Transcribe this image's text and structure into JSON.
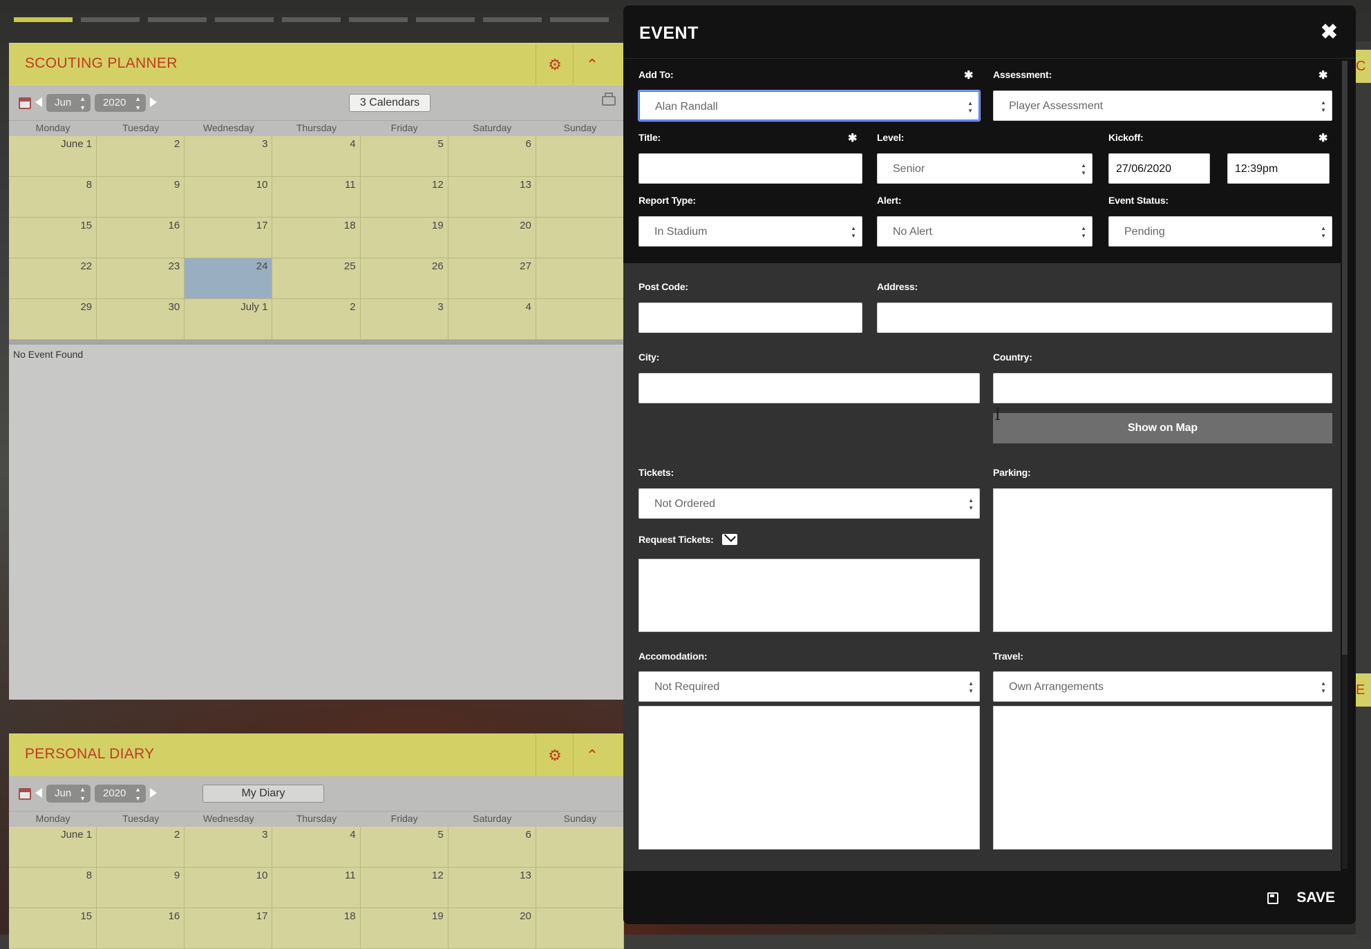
{
  "scouting": {
    "title": "SCOUTING PLANNER",
    "month": "Jun",
    "year": "2020",
    "calendars_label": "3 Calendars",
    "no_event": "No Event Found"
  },
  "days": [
    "Monday",
    "Tuesday",
    "Wednesday",
    "Thursday",
    "Friday",
    "Saturday",
    "Sunday"
  ],
  "weeks": [
    [
      "June 1",
      "2",
      "3",
      "4",
      "5",
      "6",
      ""
    ],
    [
      "8",
      "9",
      "10",
      "11",
      "12",
      "13",
      ""
    ],
    [
      "15",
      "16",
      "17",
      "18",
      "19",
      "20",
      ""
    ],
    [
      "22",
      "23",
      "24",
      "25",
      "26",
      "27",
      ""
    ],
    [
      "29",
      "30",
      "July 1",
      "2",
      "3",
      "4",
      ""
    ]
  ],
  "diary": {
    "title": "PERSONAL DIARY",
    "month": "Jun",
    "year": "2020",
    "calendars_label": "My Diary"
  },
  "diary_weeks": [
    [
      "June 1",
      "2",
      "3",
      "4",
      "5",
      "6",
      ""
    ],
    [
      "8",
      "9",
      "10",
      "11",
      "12",
      "13",
      ""
    ],
    [
      "15",
      "16",
      "17",
      "18",
      "19",
      "20",
      ""
    ]
  ],
  "modal": {
    "title": "EVENT",
    "labels": {
      "add_to": "Add To:",
      "assessment": "Assessment:",
      "title": "Title:",
      "level": "Level:",
      "kickoff": "Kickoff:",
      "report_type": "Report Type:",
      "alert": "Alert:",
      "event_status": "Event Status:",
      "post_code": "Post Code:",
      "address": "Address:",
      "city": "City:",
      "country": "Country:",
      "tickets": "Tickets:",
      "parking": "Parking:",
      "request_tickets": "Request Tickets:",
      "accomodation": "Accomodation:",
      "travel": "Travel:"
    },
    "values": {
      "add_to": "Alan Randall",
      "assessment": "Player Assessment",
      "level": "Senior",
      "kickoff_date": "27/06/2020",
      "kickoff_time": "12:39pm",
      "report_type": "In Stadium",
      "alert": "No Alert",
      "event_status": "Pending",
      "tickets": "Not Ordered",
      "accomodation": "Not Required",
      "travel": "Own Arrangements"
    },
    "show_on_map": "Show on Map",
    "save": "SAVE",
    "required_mark": "✱"
  },
  "icons": {
    "close": "close-icon",
    "gear": "gear-icon",
    "chevron_up": "chevron-up-icon",
    "calendar": "calendar-icon",
    "print": "print-icon",
    "mail": "mail-icon",
    "save": "save-icon"
  },
  "colors": {
    "header_yellow": "#d3d165",
    "title_red": "#c23a1f",
    "cell_yellow": "#d4d39b",
    "today_blue": "#9aaec1",
    "modal_bg": "#121212",
    "focus_blue": "#4d7fff"
  }
}
